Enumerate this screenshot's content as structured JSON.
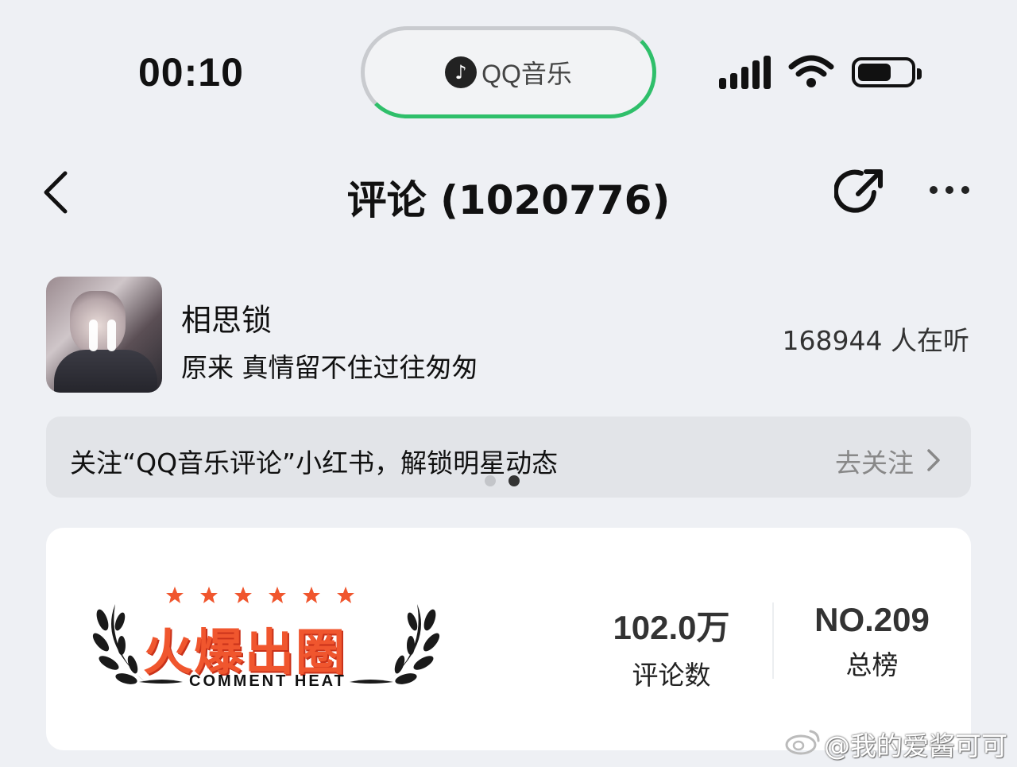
{
  "status": {
    "time": "00:10",
    "island_text": "QQ音乐"
  },
  "nav": {
    "title": "评论 (1020776)"
  },
  "song": {
    "name": "相思锁",
    "lyric": "原来 真情留不住过往匆匆",
    "listeners": "168944 人在听"
  },
  "banner": {
    "text": "关注“QQ音乐评论”小红书，解锁明星动态",
    "action": "去关注",
    "active_dot": 2,
    "dot_count": 2
  },
  "heat": {
    "badge_title": "火爆出圈",
    "badge_subtitle": "COMMENT HEAT",
    "stats": [
      {
        "value": "102.0万",
        "label": "评论数"
      },
      {
        "value": "NO.209",
        "label": "总榜"
      }
    ]
  },
  "watermark": "@我的爱酱可可",
  "colors": {
    "accent_green": "#2fbf6a",
    "heat_orange": "#f0562e",
    "background": "#eef0f4"
  }
}
